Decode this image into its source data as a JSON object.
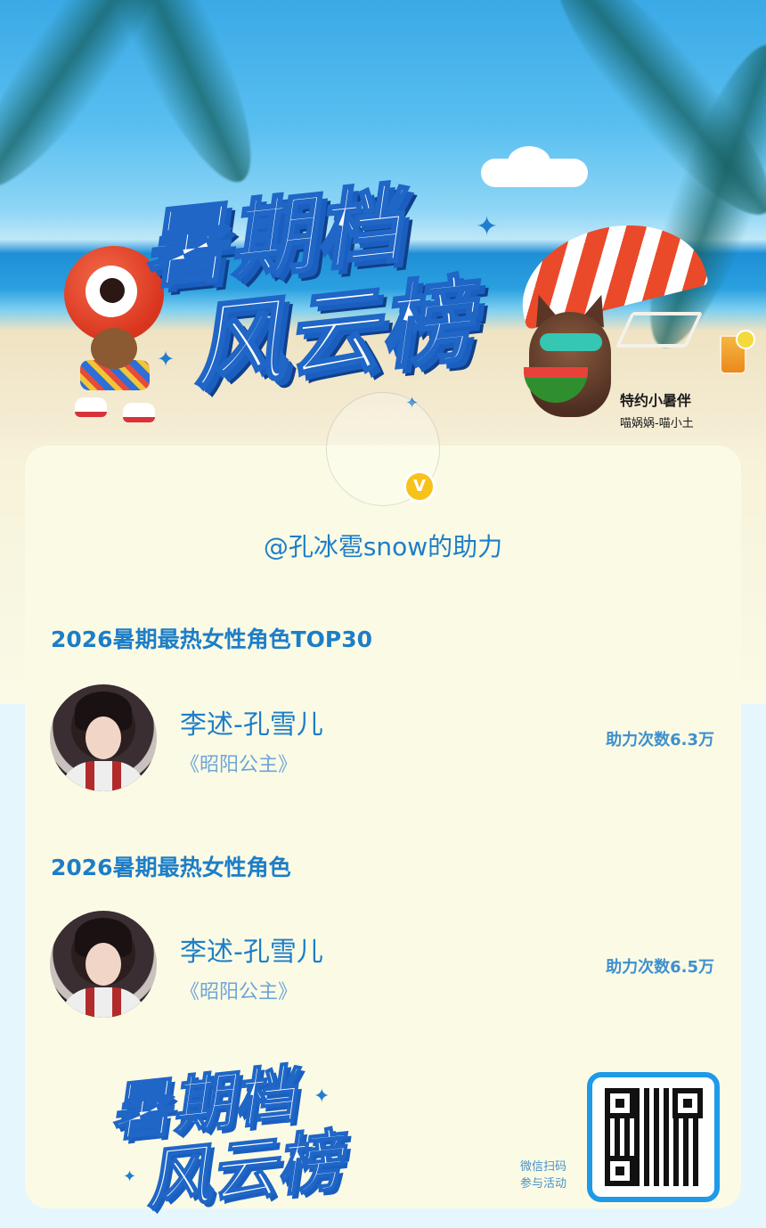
{
  "hero": {
    "title_line1": "暑期档",
    "title_line2": "风云榜",
    "sponsor_title": "特约小暑伴",
    "sponsor_sub": "喵娲娲-喵小土"
  },
  "profile": {
    "badge": "V",
    "helper_text": "@孔冰雹snow的助力"
  },
  "sections": [
    {
      "title": "2026暑期最热女性角色TOP30",
      "entry": {
        "name": "李述-孔雪儿",
        "work": "《昭阳公主》",
        "count": "助力次数6.3万"
      }
    },
    {
      "title": "2026暑期最热女性角色",
      "entry": {
        "name": "李述-孔雪儿",
        "work": "《昭阳公主》",
        "count": "助力次数6.5万"
      }
    }
  ],
  "footer": {
    "logo_line1": "暑期档",
    "logo_line2": "风云榜",
    "scan_line1": "微信扫码",
    "scan_line2": "参与活动"
  },
  "colors": {
    "accent_blue": "#1d7ec8",
    "card_bg": "#fbfbe5",
    "page_bg": "#e6f6fd",
    "badge_yellow": "#f7c21a",
    "qr_border": "#1e9ae8"
  }
}
